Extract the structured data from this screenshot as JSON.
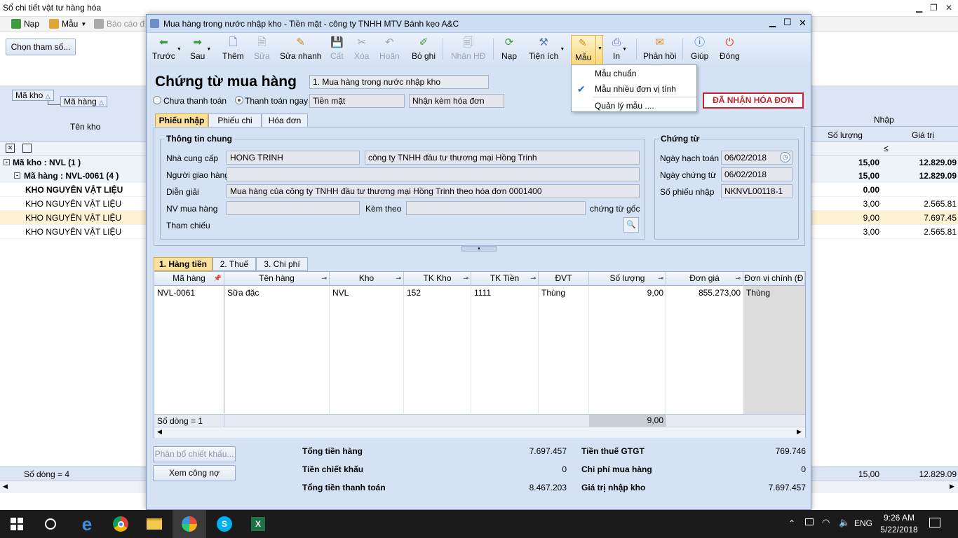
{
  "bg_window": {
    "title": "Sổ chi tiết vật tư hàng hóa",
    "toolbar": {
      "nap": "Nạp",
      "mau": "Mẫu",
      "bao_cao": "Báo cáo đ"
    },
    "param_button": "Chọn tham số...",
    "group_chips": [
      "Mã kho",
      "Mã hàng"
    ],
    "col_ten_kho": "Tên kho",
    "col_nhap": "Nhập",
    "col_so_luong": "Số lượng",
    "col_gia_tri": "Giá trị",
    "filter_le": "≤",
    "rows": [
      {
        "label": "Mã kho : NVL (1 )",
        "qty": "15,00",
        "val": "12.829.09"
      },
      {
        "label": "Mã hàng : NVL-0061 (4 )",
        "qty": "15,00",
        "val": "12.829.09"
      },
      {
        "label": "KHO NGUYÊN VẬT LIỆU",
        "qty": "0.00",
        "val": ""
      },
      {
        "label": "KHO NGUYÊN VẬT LIỆU",
        "qty": "3,00",
        "val": "2.565.81"
      },
      {
        "label": "KHO NGUYÊN VẬT LIỆU",
        "qty": "9,00",
        "val": "7.697.45"
      },
      {
        "label": "KHO NGUYÊN VẬT LIỆU",
        "qty": "3,00",
        "val": "2.565.81"
      }
    ],
    "footer": {
      "rows": "Số dòng = 4",
      "qty": "15,00",
      "val": "12.829.09"
    }
  },
  "modal": {
    "title": "Mua hàng trong nước nhập kho - Tiền mặt - công ty TNHH MTV Bánh kẹo A&C",
    "toolbar": [
      "Trước",
      "Sau",
      "Thêm",
      "Sửa",
      "Sửa nhanh",
      "Cất",
      "Xóa",
      "Hoãn",
      "Bỏ ghi",
      "Nhận HĐ",
      "Nạp",
      "Tiện ích",
      "Mẫu",
      "In",
      "Phản hồi",
      "Giúp",
      "Đóng"
    ],
    "heading": "Chứng từ mua hàng",
    "type_select": "1. Mua hàng trong nước nhập kho",
    "radio_unpaid": "Chưa thanh toán",
    "radio_paid": "Thanh toán ngay",
    "pay_method": "Tiền mặt",
    "invoice_mode": "Nhận kèm hóa đơn",
    "status": "ĐÃ NHẬN HÓA ĐƠN",
    "tabs": [
      "Phiếu nhập",
      "Phiếu chi",
      "Hóa đơn"
    ],
    "general": {
      "title": "Thông tin chung",
      "supplier_label": "Nhà cung cấp",
      "supplier_code": "HONG TRINH",
      "supplier_name": "công ty TNHH đầu tư thương mại Hồng Trinh",
      "deliverer_label": "Người giao hàng",
      "desc_label": "Diễn giải",
      "desc_value": "Mua hàng của công ty TNHH đầu tư thương mại Hồng Trinh theo hóa đơn 0001400",
      "buyer_label": "NV mua hàng",
      "attach_label": "Kèm theo",
      "orig_doc_label": "chứng từ gốc",
      "ref_label": "Tham chiếu"
    },
    "voucher": {
      "title": "Chứng từ",
      "posting_date_label": "Ngày hạch toán",
      "posting_date": "06/02/2018",
      "doc_date_label": "Ngày chứng từ",
      "doc_date": "06/02/2018",
      "doc_no_label": "Số phiếu nhập",
      "doc_no": "NKNVL00118-1"
    },
    "detail_tabs": [
      "1. Hàng tiền",
      "2. Thuế",
      "3. Chi phí"
    ],
    "grid": {
      "headers": [
        "Mã hàng",
        "Tên hàng",
        "Kho",
        "TK Kho",
        "TK Tiền",
        "ĐVT",
        "Số lượng",
        "Đơn giá",
        "Đơn vị chính (Đ"
      ],
      "row": [
        "NVL-0061",
        "Sữa đặc",
        "NVL",
        "152",
        "1111",
        "Thùng",
        "9,00",
        "855.273,00",
        "Thùng"
      ],
      "footer_count": "Số dòng = 1",
      "footer_qty": "9,00"
    },
    "buttons": {
      "allocate": "Phân bổ chiết khấu...",
      "debt": "Xem công nợ"
    },
    "totals": {
      "tong_tien_hang_label": "Tổng tiền hàng",
      "tong_tien_hang": "7.697.457",
      "chiet_khau_label": "Tiền chiết khấu",
      "chiet_khau": "0",
      "thanh_toan_label": "Tổng tiền thanh toán",
      "thanh_toan": "8.467.203",
      "thue_label": "Tiền thuế GTGT",
      "thue": "769.746",
      "chi_phi_label": "Chi phí mua hàng",
      "chi_phi": "0",
      "nhap_kho_label": "Giá trị nhập kho",
      "nhap_kho": "7.697.457"
    },
    "menu": [
      "Mẫu chuẩn",
      "Mẫu nhiều đơn vị tính",
      "Quản lý mẫu ...."
    ]
  },
  "taskbar": {
    "lang": "ENG",
    "time": "9:26 AM",
    "date": "5/22/2018"
  },
  "colors": {
    "accent": "#d5e2f4",
    "status_red": "#c8232c",
    "highlight": "#fbe19a"
  }
}
